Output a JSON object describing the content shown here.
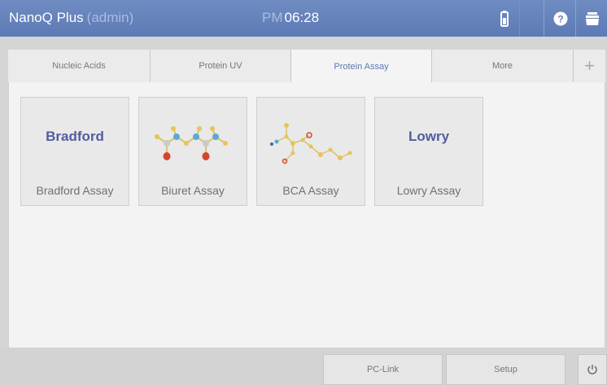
{
  "header": {
    "app_name": "NanoQ Plus",
    "user": "(admin)",
    "time_ampm": "PM",
    "time": "06:28",
    "icons": [
      "battery-icon",
      "help-icon",
      "folder-icon"
    ]
  },
  "tabs": [
    {
      "label": "Nucleic Acids",
      "active": false
    },
    {
      "label": "Protein UV",
      "active": false
    },
    {
      "label": "Protein Assay",
      "active": true
    },
    {
      "label": "More",
      "active": false
    },
    {
      "label": "+",
      "active": false
    }
  ],
  "assays": [
    {
      "logo": "Bradford",
      "label": "Bradford Assay"
    },
    {
      "logo": "",
      "label": "Biuret Assay",
      "icon": "biuret-molecule-icon"
    },
    {
      "logo": "",
      "label": "BCA Assay",
      "icon": "bca-molecule-icon"
    },
    {
      "logo": "Lowry",
      "label": "Lowry Assay"
    }
  ],
  "footer": {
    "pclink_label": "PC-Link",
    "setup_label": "Setup",
    "power_icon": "power-icon"
  },
  "colors": {
    "header_bg": "#6580bb",
    "active_tab_text": "#5b79b4",
    "logo_text": "#505d9e"
  }
}
